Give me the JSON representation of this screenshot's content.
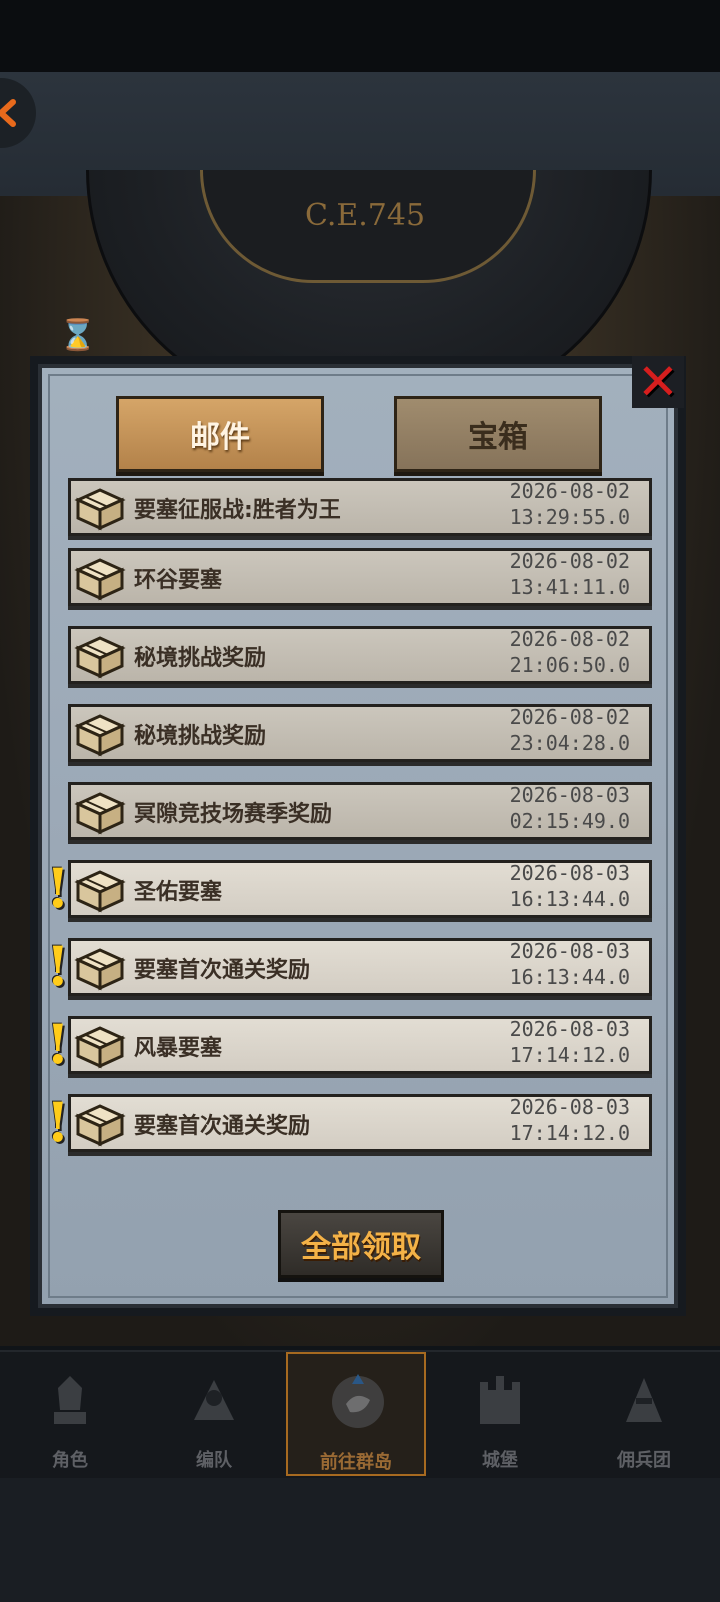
{
  "era_label": "C.E.745",
  "tabs": [
    {
      "label": "邮件",
      "active": true
    },
    {
      "label": "宝箱",
      "active": false
    }
  ],
  "mails": [
    {
      "title": "要塞征服战:胜者为王",
      "date": "2026-08-02",
      "time": "13:29:55.0",
      "unread": false
    },
    {
      "title": "环谷要塞",
      "date": "2026-08-02",
      "time": "13:41:11.0",
      "unread": false
    },
    {
      "title": "秘境挑战奖励",
      "date": "2026-08-02",
      "time": "21:06:50.0",
      "unread": false
    },
    {
      "title": "秘境挑战奖励",
      "date": "2026-08-02",
      "time": "23:04:28.0",
      "unread": false
    },
    {
      "title": "冥隙竞技场赛季奖励",
      "date": "2026-08-03",
      "time": "02:15:49.0",
      "unread": false
    },
    {
      "title": "圣佑要塞",
      "date": "2026-08-03",
      "time": "16:13:44.0",
      "unread": true
    },
    {
      "title": "要塞首次通关奖励",
      "date": "2026-08-03",
      "time": "16:13:44.0",
      "unread": true
    },
    {
      "title": "风暴要塞",
      "date": "2026-08-03",
      "time": "17:14:12.0",
      "unread": true
    },
    {
      "title": "要塞首次通关奖励",
      "date": "2026-08-03",
      "time": "17:14:12.0",
      "unread": true
    }
  ],
  "claim_all_label": "全部领取",
  "unread_marker": "!",
  "close_glyph": "✕",
  "nav": [
    {
      "label": "角色",
      "icon": "knight-icon",
      "active": false
    },
    {
      "label": "编队",
      "icon": "squad-icon",
      "active": false
    },
    {
      "label": "前往群岛",
      "icon": "island-compass-icon",
      "active": true
    },
    {
      "label": "城堡",
      "icon": "castle-icon",
      "active": false
    },
    {
      "label": "佣兵团",
      "icon": "mercenary-icon",
      "active": false
    }
  ],
  "colors": {
    "accent": "#f4b247",
    "unread_marker": "#ffcc1a",
    "close": "#d61e1e"
  }
}
